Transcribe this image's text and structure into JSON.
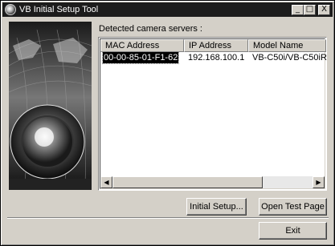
{
  "window": {
    "title": "VB Initial Setup Tool"
  },
  "titlebar_buttons": {
    "minimize": "_",
    "maximize": "□",
    "close": "X"
  },
  "main": {
    "label": "Detected camera servers :",
    "table": {
      "columns": [
        "MAC Address",
        "IP Address",
        "Model Name"
      ],
      "rows": [
        {
          "mac": "00-00-85-01-F1-62",
          "ip": "192.168.100.1",
          "model": "VB-C50i/VB-C50iR",
          "selected": true
        }
      ]
    },
    "scroll_arrows": {
      "left": "◀",
      "right": "▶"
    }
  },
  "buttons": {
    "initial_setup": "Initial Setup...",
    "open_test_page": "Open Test Page",
    "exit": "Exit"
  }
}
